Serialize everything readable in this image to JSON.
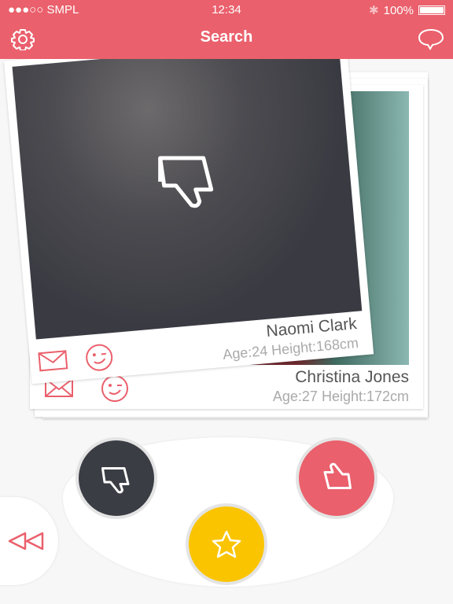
{
  "status_bar": {
    "carrier": "●●●○○ SMPL",
    "time": "12:34",
    "battery": "100%"
  },
  "header": {
    "title": "Search",
    "left_icon": "gear-icon",
    "right_icon": "chat-bubble-icon"
  },
  "colors": {
    "accent": "#ea606c",
    "dark": "#3b3d45",
    "star": "#fbc400"
  },
  "cards": [
    {
      "name": "Naomi Clark",
      "meta": "Age:24  Height:168cm",
      "overlay_icon": "thumbs-down-icon"
    },
    {
      "name": "Christina Jones",
      "meta": "Age:27  Height:172cm"
    }
  ],
  "controls": {
    "dislike": "thumbs-down-icon",
    "like": "thumbs-up-icon",
    "favorite": "star-icon",
    "rewind": "rewind-icon"
  }
}
